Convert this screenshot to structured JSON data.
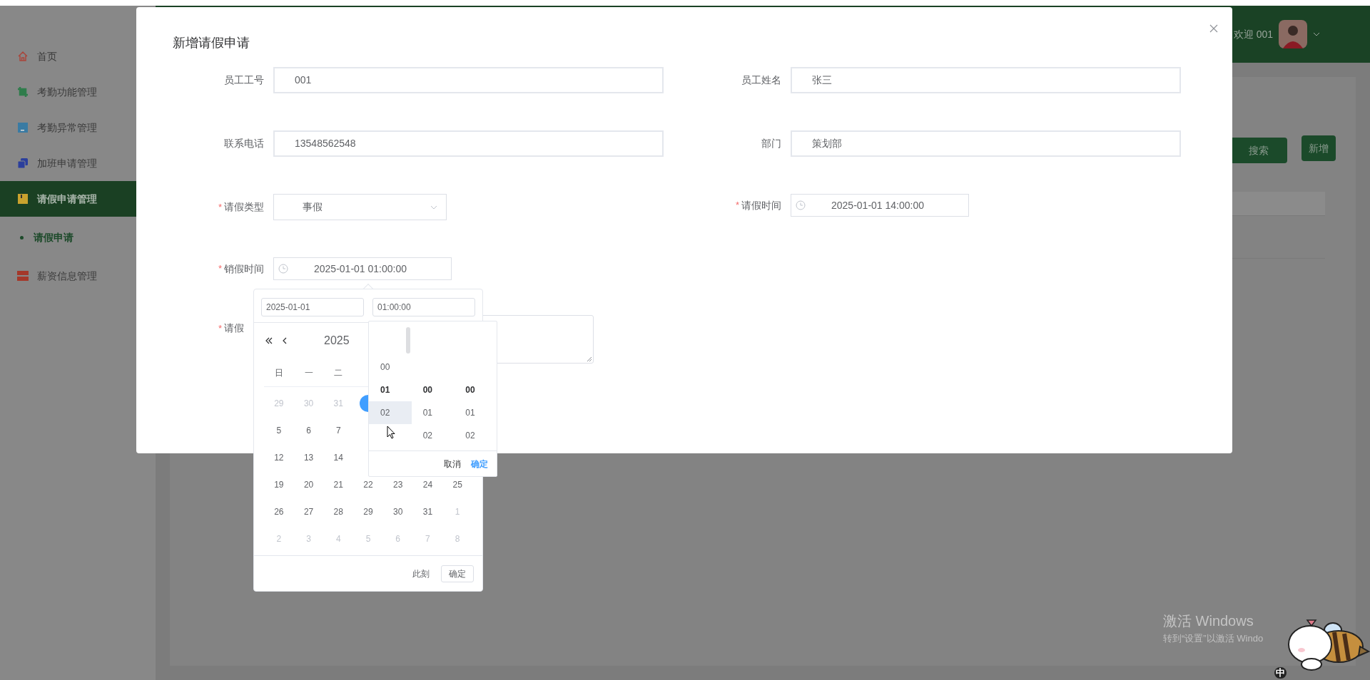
{
  "header": {
    "greeting": "欢迎 001"
  },
  "sidebar": {
    "items": [
      {
        "label": "首页",
        "color": "#a8473c",
        "selected": false
      },
      {
        "label": "考勤功能管理",
        "color": "#2f7c4b",
        "selected": false
      },
      {
        "label": "考勤异常管理",
        "color": "#3a7ba3",
        "selected": false
      },
      {
        "label": "加班申请管理",
        "color": "#2b3f9c",
        "selected": false
      },
      {
        "label": "请假申请管理",
        "color": "#c9a22e",
        "selected": true,
        "children": [
          {
            "label": "请假申请",
            "selected": true
          }
        ]
      },
      {
        "label": "薪资信息管理",
        "color": "#a4382a",
        "selected": false
      }
    ]
  },
  "toolbar": {
    "buttons": [
      "搜索",
      "新增"
    ]
  },
  "dialog": {
    "title": "新增请假申请",
    "fields": [
      {
        "kind": "text",
        "label": "员工工号",
        "value": "001"
      },
      {
        "kind": "text",
        "label": "员工姓名",
        "value": "张三"
      },
      {
        "kind": "text",
        "label": "联系电话",
        "value": "13548562548"
      },
      {
        "kind": "text",
        "label": "部门",
        "value": "策划部"
      },
      {
        "kind": "select",
        "label": "请假类型",
        "required_mark": "*",
        "value": "事假"
      },
      {
        "kind": "datetime",
        "label": "请假时间",
        "required_mark": "*",
        "value": "2025-01-01 14:00:00"
      },
      {
        "kind": "datetime",
        "label": "销假时间",
        "required_mark": "*",
        "value": "2025-01-01 01:00:00"
      },
      {
        "kind": "textarea",
        "label": "请假",
        "required_mark": "*"
      }
    ]
  },
  "date_picker": {
    "date_input": "2025-01-01",
    "time_input": "01:00:00",
    "year_label": "2025",
    "weekdays": [
      "日",
      "一",
      "二"
    ],
    "weeks": [
      {
        "cells": [
          {
            "day": "29",
            "muted": true,
            "selected": false
          },
          {
            "day": "30",
            "muted": true,
            "selected": false
          },
          {
            "day": "31",
            "muted": true,
            "selected": false
          },
          {
            "muted": false,
            "selected": true
          }
        ]
      },
      {
        "cells": [
          {
            "day": "5",
            "muted": false,
            "selected": false
          },
          {
            "day": "6",
            "muted": false,
            "selected": false
          },
          {
            "day": "7",
            "muted": false,
            "selected": false
          }
        ]
      },
      {
        "cells": [
          {
            "day": "12",
            "muted": false,
            "selected": false
          },
          {
            "day": "13",
            "muted": false,
            "selected": false
          },
          {
            "day": "14",
            "muted": false,
            "selected": false
          }
        ]
      },
      {
        "cells": [
          {
            "day": "19",
            "muted": false,
            "selected": false
          },
          {
            "day": "20",
            "muted": false,
            "selected": false
          },
          {
            "day": "21",
            "muted": false,
            "selected": false
          },
          {
            "day": "22",
            "muted": false,
            "selected": false
          },
          {
            "day": "23",
            "muted": false,
            "selected": false
          },
          {
            "day": "24",
            "muted": false,
            "selected": false
          },
          {
            "day": "25",
            "muted": false,
            "selected": false
          }
        ]
      },
      {
        "cells": [
          {
            "day": "26",
            "muted": false,
            "selected": false
          },
          {
            "day": "27",
            "muted": false,
            "selected": false
          },
          {
            "day": "28",
            "muted": false,
            "selected": false
          },
          {
            "day": "29",
            "muted": false,
            "selected": false
          },
          {
            "day": "30",
            "muted": false,
            "selected": false
          },
          {
            "day": "31",
            "muted": false,
            "selected": false
          },
          {
            "day": "1",
            "muted": true,
            "selected": false
          }
        ]
      },
      {
        "cells": [
          {
            "day": "2",
            "muted": true,
            "selected": false
          },
          {
            "day": "3",
            "muted": true,
            "selected": false
          },
          {
            "day": "4",
            "muted": true,
            "selected": false
          },
          {
            "day": "5",
            "muted": true,
            "selected": false
          },
          {
            "day": "6",
            "muted": true,
            "selected": false
          },
          {
            "day": "7",
            "muted": true,
            "selected": false
          },
          {
            "day": "8",
            "muted": true,
            "selected": false
          }
        ]
      }
    ],
    "now_link": "此刻",
    "confirm": "确定",
    "time_panel": {
      "columns": [
        {
          "items": [
            {
              "text": "00",
              "selected": false,
              "hovered": false
            },
            {
              "text": "01",
              "selected": true,
              "hovered": false
            },
            {
              "text": "02",
              "selected": false,
              "hovered": true
            }
          ]
        },
        {
          "items": [
            {
              "text": "00",
              "selected": true,
              "hovered": false
            },
            {
              "text": "01",
              "selected": false,
              "hovered": false
            },
            {
              "text": "02",
              "selected": false,
              "hovered": false
            }
          ]
        },
        {
          "items": [
            {
              "text": "00",
              "selected": true,
              "hovered": false
            },
            {
              "text": "01",
              "selected": false,
              "hovered": false
            },
            {
              "text": "02",
              "selected": false,
              "hovered": false
            }
          ]
        }
      ],
      "cancel": "取消",
      "confirm": "确定"
    }
  },
  "system": {
    "activation_title": "激活 Windows",
    "activation_hint": "转到“设置”以激活 Windo",
    "ime": "中"
  }
}
